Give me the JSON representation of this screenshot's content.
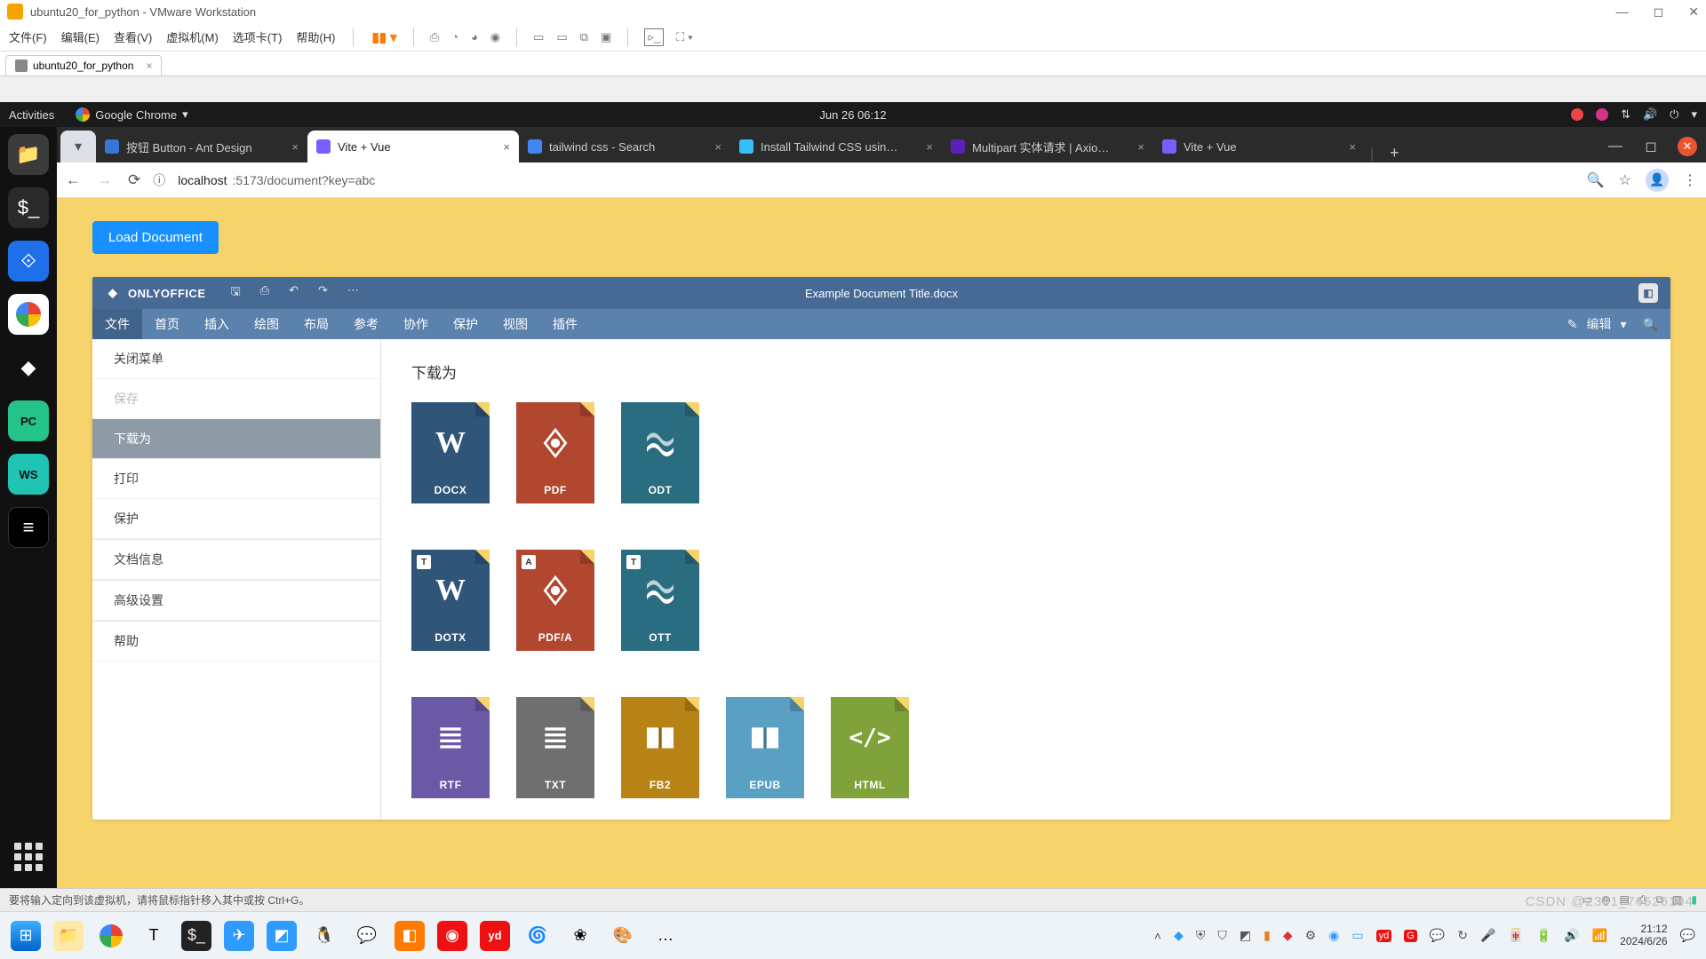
{
  "vmware": {
    "title": "ubuntu20_for_python - VMware Workstation",
    "menus": [
      "文件(F)",
      "编辑(E)",
      "查看(V)",
      "虚拟机(M)",
      "选项卡(T)",
      "帮助(H)"
    ],
    "tab": "ubuntu20_for_python",
    "status": "要将输入定向到该虚拟机，请将鼠标指针移入其中或按 Ctrl+G。"
  },
  "gnome": {
    "activities": "Activities",
    "app": "Google Chrome",
    "clock": "Jun 26  06:12"
  },
  "chrome": {
    "tabs": [
      {
        "title": "按钮 Button - Ant Design",
        "fav": "#3875d7",
        "active": false
      },
      {
        "title": "Vite + Vue",
        "fav": "#7a5cff",
        "active": true
      },
      {
        "title": "tailwind css - Search",
        "fav": "#4285f4",
        "active": false
      },
      {
        "title": "Install Tailwind CSS usin…",
        "fav": "#38bdf8",
        "active": false
      },
      {
        "title": "Multipart 实体请求 | Axio…",
        "fav": "#5b21b6",
        "active": false
      },
      {
        "title": "Vite + Vue",
        "fav": "#7a5cff",
        "active": false
      }
    ],
    "url_host": "localhost",
    "url_rest": ":5173/document?key=abc"
  },
  "page": {
    "load_btn": "Load Document"
  },
  "onlyoffice": {
    "brand": "ONLYOFFICE",
    "doc_title": "Example Document Title.docx",
    "edit_label": "编辑",
    "menu": [
      "文件",
      "首页",
      "插入",
      "绘图",
      "布局",
      "参考",
      "协作",
      "保护",
      "视图",
      "插件"
    ],
    "menu_active_index": 0,
    "side": [
      {
        "label": "关闭菜单"
      },
      {
        "label": "保存",
        "disabled": true
      },
      {
        "label": "下载为",
        "selected": true
      },
      {
        "label": "打印"
      },
      {
        "label": "保护"
      },
      {
        "label": "文档信息",
        "sep_before": true
      },
      {
        "label": "高级设置",
        "sep_before": true
      },
      {
        "label": "帮助",
        "sep_before": true
      }
    ],
    "panel_title": "下载为",
    "formats": [
      {
        "label": "DOCX",
        "color": "#2f5579",
        "icon": "W"
      },
      {
        "label": "PDF",
        "color": "#b1472f",
        "icon": "pdf"
      },
      {
        "label": "ODT",
        "color": "#2b6d80",
        "icon": "odt"
      },
      {
        "label": "DOTX",
        "color": "#2f5579",
        "icon": "W",
        "tag": "T"
      },
      {
        "label": "PDF/A",
        "color": "#b1472f",
        "icon": "pdf",
        "tag": "A"
      },
      {
        "label": "OTT",
        "color": "#2b6d80",
        "icon": "odt",
        "tag": "T"
      },
      {
        "label": "RTF",
        "color": "#6a5aa6",
        "icon": "lines"
      },
      {
        "label": "TXT",
        "color": "#6f6f6f",
        "icon": "lines"
      },
      {
        "label": "FB2",
        "color": "#b88316",
        "icon": "book"
      },
      {
        "label": "EPUB",
        "color": "#5aa0c2",
        "icon": "book"
      },
      {
        "label": "HTML",
        "color": "#7fa23b",
        "icon": "code"
      }
    ]
  },
  "win": {
    "clock_time": "21:12",
    "clock_date": "2024/6/26",
    "overflow": "…"
  },
  "watermark": "CSDN @2301_76526194"
}
